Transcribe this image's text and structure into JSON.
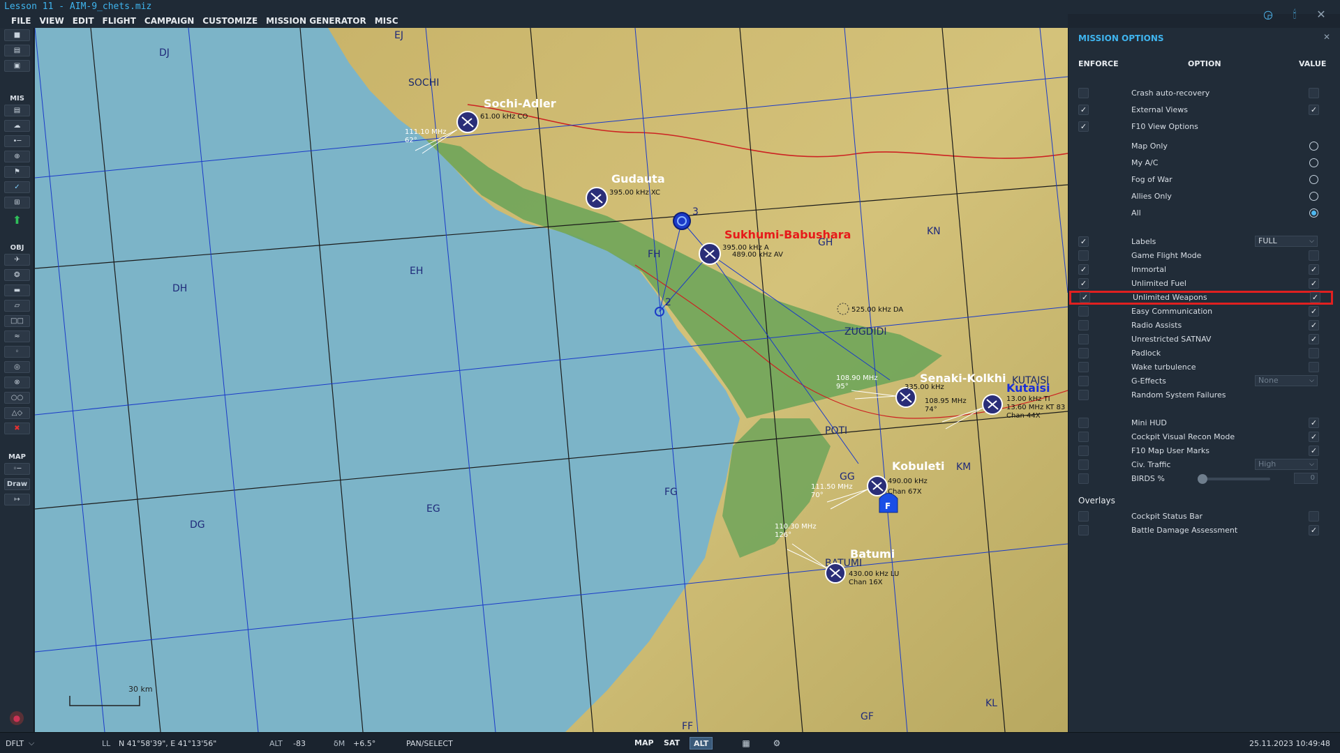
{
  "window": {
    "title": "Lesson 11 - AIM-9_chets.miz",
    "icons": [
      "wifi-icon",
      "antenna-icon",
      "close-icon"
    ]
  },
  "menu": [
    "FILE",
    "VIEW",
    "EDIT",
    "FLIGHT",
    "CAMPAIGN",
    "CUSTOMIZE",
    "MISSION GENERATOR",
    "MISC"
  ],
  "toolbar": {
    "sections": {
      "mis": "MIS",
      "obj": "OBJ",
      "map": "MAP"
    },
    "draw_label": "Draw"
  },
  "map": {
    "grid_labels": [
      "EJ",
      "DJ",
      "SOCHI",
      "DH",
      "EH",
      "FH",
      "GH",
      "KN",
      "ZUGDIDI",
      "POTI",
      "GG",
      "KM",
      "FG",
      "EG",
      "DG",
      "BATUMI",
      "GF",
      "FF",
      "KL",
      "KUTAISI"
    ],
    "airbases": [
      {
        "name": "Sochi-Adler",
        "info": "61.00 kHz CO",
        "ils": "111.10 MHz",
        "hdg": "62°"
      },
      {
        "name": "Gudauta",
        "info": "395.00 kHz XC"
      },
      {
        "name": "Sukhumi-Babushara",
        "info1": "395.00 kHz A",
        "info2": "489.00 kHz AV"
      },
      {
        "name": "Senaki-Kolkhi",
        "ils": "108.90 MHz",
        "hdg": "95°",
        "info": "335.00 kHz",
        "info2": "108.95 MHz",
        "info3": "74°"
      },
      {
        "name": "Kutaisi",
        "info1": "13.00 kHz TI",
        "info2": "13.60 MHz KT 83",
        "info3": "Chan 44X"
      },
      {
        "name": "Kobuleti",
        "ils": "111.50 MHz",
        "hdg": "70°",
        "info1": "490.00 kHz",
        "info2": "Chan 67X"
      },
      {
        "name": "Batumi",
        "ils": "110.30 MHz",
        "hdg": "126°",
        "info1": "430.00 kHz LU",
        "info2": "Chan 16X"
      }
    ],
    "ndb": "525.00 kHz DA",
    "waypoints": [
      "2",
      "3"
    ],
    "scale": "30 km",
    "farp_label": "F"
  },
  "mission_options": {
    "title": "MISSION OPTIONS",
    "headers": {
      "enforce": "ENFORCE",
      "option": "OPTION",
      "value": "VALUE"
    },
    "rows": [
      {
        "label": "Crash auto-recovery",
        "enforce": false,
        "value": false,
        "kind": "check"
      },
      {
        "label": "External Views",
        "enforce": true,
        "value": true,
        "kind": "check"
      },
      {
        "label": "F10 View Options",
        "enforce": true,
        "kind": "header"
      },
      {
        "label": "Map Only",
        "kind": "radio",
        "selected": false
      },
      {
        "label": "My A/C",
        "kind": "radio",
        "selected": false
      },
      {
        "label": "Fog of War",
        "kind": "radio",
        "selected": false
      },
      {
        "label": "Allies Only",
        "kind": "radio",
        "selected": false
      },
      {
        "label": "All",
        "kind": "radio",
        "selected": true
      },
      {
        "label": "Labels",
        "enforce": true,
        "kind": "dropdown",
        "value": "FULL"
      },
      {
        "label": "Game Flight Mode",
        "enforce": false,
        "value": false,
        "kind": "check"
      },
      {
        "label": "Immortal",
        "enforce": true,
        "value": true,
        "kind": "check"
      },
      {
        "label": "Unlimited Fuel",
        "enforce": true,
        "value": true,
        "kind": "check"
      },
      {
        "label": "Unlimited Weapons",
        "enforce": true,
        "value": true,
        "kind": "check",
        "highlight": true
      },
      {
        "label": "Easy Communication",
        "enforce": false,
        "value": true,
        "kind": "check"
      },
      {
        "label": "Radio Assists",
        "enforce": false,
        "value": true,
        "kind": "check"
      },
      {
        "label": "Unrestricted SATNAV",
        "enforce": false,
        "value": true,
        "kind": "check"
      },
      {
        "label": "Padlock",
        "enforce": false,
        "value": false,
        "kind": "check"
      },
      {
        "label": "Wake turbulence",
        "enforce": false,
        "value": false,
        "kind": "check"
      },
      {
        "label": "G-Effects",
        "enforce": false,
        "kind": "dropdown",
        "value": "None",
        "dim": true
      },
      {
        "label": "Random System Failures",
        "enforce": false,
        "kind": "none"
      },
      {
        "label": "Mini HUD",
        "enforce": false,
        "value": true,
        "kind": "check"
      },
      {
        "label": "Cockpit Visual Recon Mode",
        "enforce": false,
        "value": true,
        "kind": "check"
      },
      {
        "label": "F10 Map User Marks",
        "enforce": false,
        "value": true,
        "kind": "check"
      },
      {
        "label": "Civ. Traffic",
        "enforce": false,
        "kind": "dropdown",
        "value": "High",
        "dim": true
      },
      {
        "label": "BIRDS %",
        "enforce": false,
        "kind": "slider",
        "value": "0"
      }
    ],
    "overlays_title": "Overlays",
    "overlays": [
      {
        "label": "Cockpit Status Bar",
        "enforce": false,
        "value": false
      },
      {
        "label": "Battle Damage Assessment",
        "enforce": false,
        "value": true
      }
    ]
  },
  "statusbar": {
    "profile": "DFLT",
    "coord_label": "LL",
    "coords": "N 41°58'39\", E 41°13'56\"",
    "alt_label": "ALT",
    "alt_value": "-83",
    "mag_label": "δM",
    "mag_value": "+6.5°",
    "mode": "PAN/SELECT",
    "map_btn": "MAP",
    "sat_btn": "SAT",
    "alt_btn": "ALT",
    "datetime": "25.11.2023 10:49:48"
  },
  "colors": {
    "accent": "#3fb4ee",
    "highlight": "#e02020",
    "sea": "#7cb4c8",
    "land_low": "#6fa55a",
    "land_mid": "#c8b460"
  }
}
